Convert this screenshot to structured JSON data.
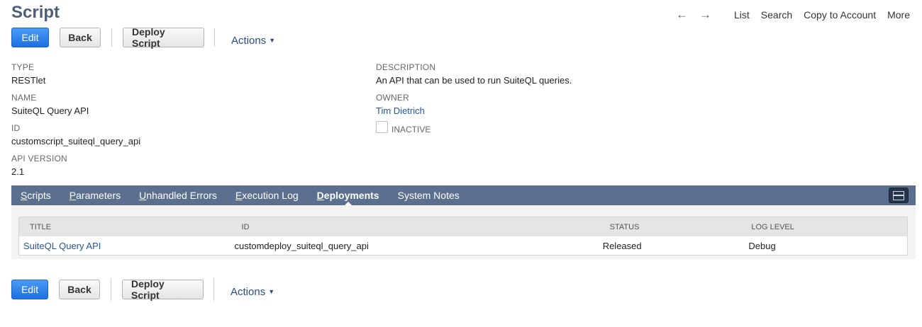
{
  "page": {
    "title": "Script"
  },
  "top_nav": {
    "back_arrow": "←",
    "forward_arrow": "→",
    "links": [
      "List",
      "Search",
      "Copy to Account",
      "More"
    ]
  },
  "buttons": {
    "edit": "Edit",
    "back": "Back",
    "deploy": "Deploy Script",
    "actions": "Actions",
    "actions_caret": "▼"
  },
  "fields": {
    "type": {
      "label": "TYPE",
      "value": "RESTlet"
    },
    "name": {
      "label": "NAME",
      "value": "SuiteQL Query API"
    },
    "id": {
      "label": "ID",
      "value": "customscript_suiteql_query_api"
    },
    "api_version": {
      "label": "API VERSION",
      "value": "2.1"
    },
    "description": {
      "label": "DESCRIPTION",
      "value": "An API that can be used to run SuiteQL queries."
    },
    "owner": {
      "label": "OWNER",
      "value": "Tim Dietrich"
    },
    "inactive": {
      "label": "INACTIVE",
      "checked": false
    }
  },
  "tabs": [
    {
      "first": "S",
      "rest": "cripts",
      "active": false
    },
    {
      "first": "P",
      "rest": "arameters",
      "active": false
    },
    {
      "first": "U",
      "rest": "nhandled Errors",
      "active": false
    },
    {
      "first": "E",
      "rest": "xecution Log",
      "active": false
    },
    {
      "first": "D",
      "rest": "eployments",
      "active": true
    },
    {
      "first": "",
      "rest": "System Notes",
      "active": false
    }
  ],
  "deployments": {
    "columns": [
      "TITLE",
      "ID",
      "STATUS",
      "LOG LEVEL"
    ],
    "rows": [
      {
        "title": "SuiteQL Query API",
        "id": "customdeploy_suiteql_query_api",
        "status": "Released",
        "log_level": "Debug"
      }
    ]
  },
  "colors": {
    "title": "#4d5f79",
    "tabbar": "#5b6f8e",
    "primary_button": "#1d6fe0",
    "link": "#255599"
  }
}
